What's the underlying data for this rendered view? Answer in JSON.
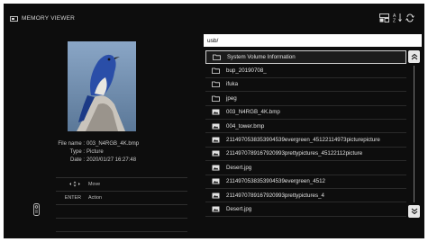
{
  "app": {
    "title": "MEMORY VIEWER"
  },
  "toolbar": {
    "icons": [
      "media-filter-icon",
      "sort-az-icon",
      "repeat-icon"
    ]
  },
  "info": {
    "file_label": "File name :",
    "file_value": "003_N4RGB_4K.bmp",
    "type_label": "Type :",
    "type_value": "Picture",
    "date_label": "Date :",
    "date_value": "2020/01/27 16:27:48"
  },
  "legend": {
    "move_key_icon": "arrow-keys-icon",
    "move_label": "Move",
    "enter_key": "ENTER",
    "action_label": "Action"
  },
  "path": "usb/",
  "items": [
    {
      "icon": "folder-icon",
      "label": "System Volume Information",
      "selected": true
    },
    {
      "icon": "folder-icon",
      "label": "bup_20190708_"
    },
    {
      "icon": "folder-icon",
      "label": "ifuka"
    },
    {
      "icon": "folder-icon",
      "label": "jpeg"
    },
    {
      "icon": "image-file-icon",
      "label": "003_N4RGB_4K.bmp"
    },
    {
      "icon": "image-file-icon",
      "label": "004_tower.bmp"
    },
    {
      "icon": "image-file-icon",
      "label": "2114970538353904539evergreen_45122114973picturepicture"
    },
    {
      "icon": "image-file-icon",
      "label": "2114970789167920993prettypictures_45122112picture"
    },
    {
      "icon": "image-file-icon",
      "label": "Desert.jpg"
    },
    {
      "icon": "image-file-icon",
      "label": "2114970538353904539evergreen_4512"
    },
    {
      "icon": "image-file-icon",
      "label": "2114970789167920993prettypictures_4"
    },
    {
      "icon": "image-file-icon",
      "label": "Desert.jpg"
    }
  ],
  "colors": {
    "background": "#0d0d0d",
    "text": "#e2e2e2",
    "path_bar": "#ffffff"
  }
}
